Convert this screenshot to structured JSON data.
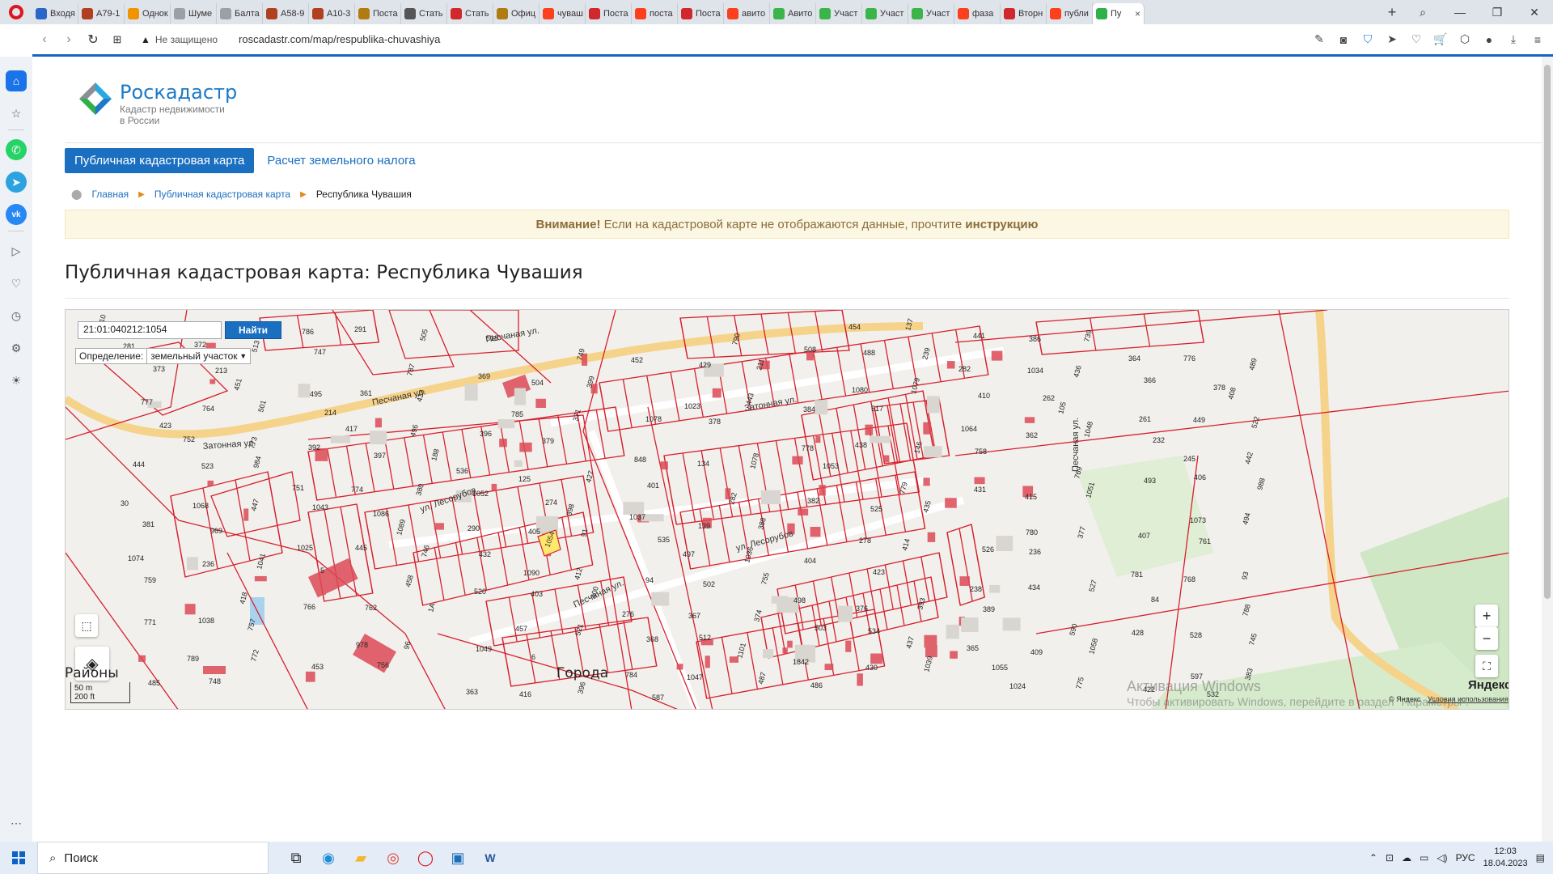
{
  "browser": {
    "tabs": [
      {
        "title": "Входя",
        "color": "#2a67c9"
      },
      {
        "title": "А79-1",
        "color": "#b04020"
      },
      {
        "title": "Однок",
        "color": "#f29400"
      },
      {
        "title": "Шуме",
        "color": "#9aa0a6"
      },
      {
        "title": "Балта",
        "color": "#9aa0a6"
      },
      {
        "title": "А58-9",
        "color": "#b04020"
      },
      {
        "title": "А10-3",
        "color": "#b04020"
      },
      {
        "title": "Поста",
        "color": "#b07b10"
      },
      {
        "title": "Стать",
        "color": "#555555"
      },
      {
        "title": "Стать",
        "color": "#d0282c"
      },
      {
        "title": "Офиц",
        "color": "#b07b10"
      },
      {
        "title": "чуваш",
        "color": "#fc3f1d"
      },
      {
        "title": "Поста",
        "color": "#d0282c"
      },
      {
        "title": "поста",
        "color": "#fc3f1d"
      },
      {
        "title": "Поста",
        "color": "#d0282c"
      },
      {
        "title": "авито",
        "color": "#fc3f1d"
      },
      {
        "title": "Авито",
        "color": "#3bb54a"
      },
      {
        "title": "Участ",
        "color": "#3bb54a"
      },
      {
        "title": "Участ",
        "color": "#3bb54a"
      },
      {
        "title": "Участ",
        "color": "#3bb54a"
      },
      {
        "title": "фаза",
        "color": "#fc3f1d"
      },
      {
        "title": "Вторн",
        "color": "#d0282c"
      },
      {
        "title": "публи",
        "color": "#fc3f1d"
      }
    ],
    "active_tab": {
      "title": "Пу",
      "close": "×"
    },
    "new_tab": "+",
    "security": "Не защищено",
    "url": "roscadastr.com/map/respublika-chuvashiya"
  },
  "site": {
    "brand": "Роскадастр",
    "tagline1": "Кадастр недвижимости",
    "tagline2": "в России",
    "nav_active": "Публичная кадастровая карта",
    "nav_link": "Расчет земельного налога",
    "crumbs": [
      "Главная",
      "Публичная кадастровая карта",
      "Республика Чувашия"
    ],
    "alert_strong": "Внимание!",
    "alert_text": " Если на кадастровой карте не отображаются данные, прочтите ",
    "alert_link": "инструкцию",
    "title": "Публичная кадастровая карта: Республика Чувашия",
    "section_left": "Районы",
    "section_right": "Города"
  },
  "map": {
    "search_value": "21:01:040212:1054",
    "search_button": "Найти",
    "def_label": "Определение:",
    "def_value": "земельный участок",
    "zoom_in": "+",
    "zoom_out": "−",
    "scale_m": "50 m",
    "scale_ft": "200 ft",
    "copyright": "© Яндекс",
    "terms": "Условия использования",
    "provider": "Яндекс",
    "watermark1": "Активация Windows",
    "watermark2": "Чтобы активировать Windows, перейдите в раздел \"Параметры\".",
    "streets": [
      "Песчаная ул.",
      "Песчаная ул.",
      "Затонная ул.",
      "Затонная ул.",
      "ул. Лесорубов",
      "ул. Лесорубов",
      "Песчаная ул.",
      "Песчаная ул."
    ],
    "parcel_highlight": "1054",
    "parcels": [
      "210",
      "213",
      "214",
      "188",
      "274",
      "535",
      "755",
      "534",
      "1055",
      "739",
      "378",
      "423",
      "984",
      "1086",
      "432",
      "400",
      "512",
      "486",
      "239",
      "262",
      "232",
      "988",
      "969",
      "5",
      "1А",
      "6",
      "587",
      "211",
      "517",
      "758",
      "1051",
      "761",
      "759",
      "757",
      "756",
      "518",
      "399",
      "378",
      "1053",
      "435",
      "236",
      "84",
      "745",
      "748",
      "747",
      "433",
      "379",
      "401",
      "388",
      "423",
      "389",
      "1058",
      "532",
      "373",
      "501",
      "397",
      "1052",
      "91",
      "502",
      "503",
      "1039",
      "386",
      "366",
      "522",
      "523",
      "1043",
      "746",
      "403",
      "368",
      "487",
      "488",
      "410",
      "1048",
      "406",
      "381",
      "1041",
      "762",
      "1049",
      "396",
      "429",
      "384",
      "146",
      "415",
      "407",
      "93",
      "1038",
      "453",
      "505",
      "504",
      "1078",
      "1078",
      "525",
      "526",
      "527",
      "528",
      "485",
      "513",
      "361",
      "396",
      "427",
      "139",
      "404",
      "393",
      "409",
      "422",
      "489",
      "764",
      "392",
      "380",
      "405",
      "94",
      "374",
      "430",
      "441",
      "436",
      "449",
      "444",
      "447",
      "445",
      "520",
      "521",
      "1047",
      "508",
      "1079",
      "362",
      "493",
      "494",
      "236",
      "766",
      "96",
      "416",
      "452",
      "443",
      "438",
      "431",
      "377",
      "768",
      "771",
      "772",
      "291",
      "369",
      "371",
      "134",
      "382",
      "414",
      "434",
      "428",
      "383",
      "372",
      "495",
      "496",
      "125",
      "1037",
      "1036",
      "376",
      "365",
      "775",
      "776",
      "777",
      "773",
      "774",
      "290",
      "412",
      "367",
      "1842",
      "137",
      "1034",
      "261",
      "442",
      "1068",
      "1025",
      "458",
      "457",
      "784",
      "790",
      "1080",
      "1064",
      "769",
      "1073",
      "1074",
      "418",
      "978",
      "363",
      "749",
      "1023",
      "778",
      "779",
      "780",
      "781",
      "788",
      "789",
      "786",
      "787",
      "785",
      "848",
      "282",
      "278",
      "238",
      "590",
      "597",
      "281",
      "451",
      "417",
      "536",
      "398",
      "497",
      "498",
      "437",
      "1024",
      "364",
      "408",
      "752",
      "751",
      "1089",
      "1090",
      "276",
      "1101",
      "454",
      "282",
      "105",
      "245",
      "30"
    ]
  },
  "taskbar": {
    "search": "Поиск",
    "lang": "РУС",
    "time": "12:03",
    "date": "18.04.2023"
  }
}
